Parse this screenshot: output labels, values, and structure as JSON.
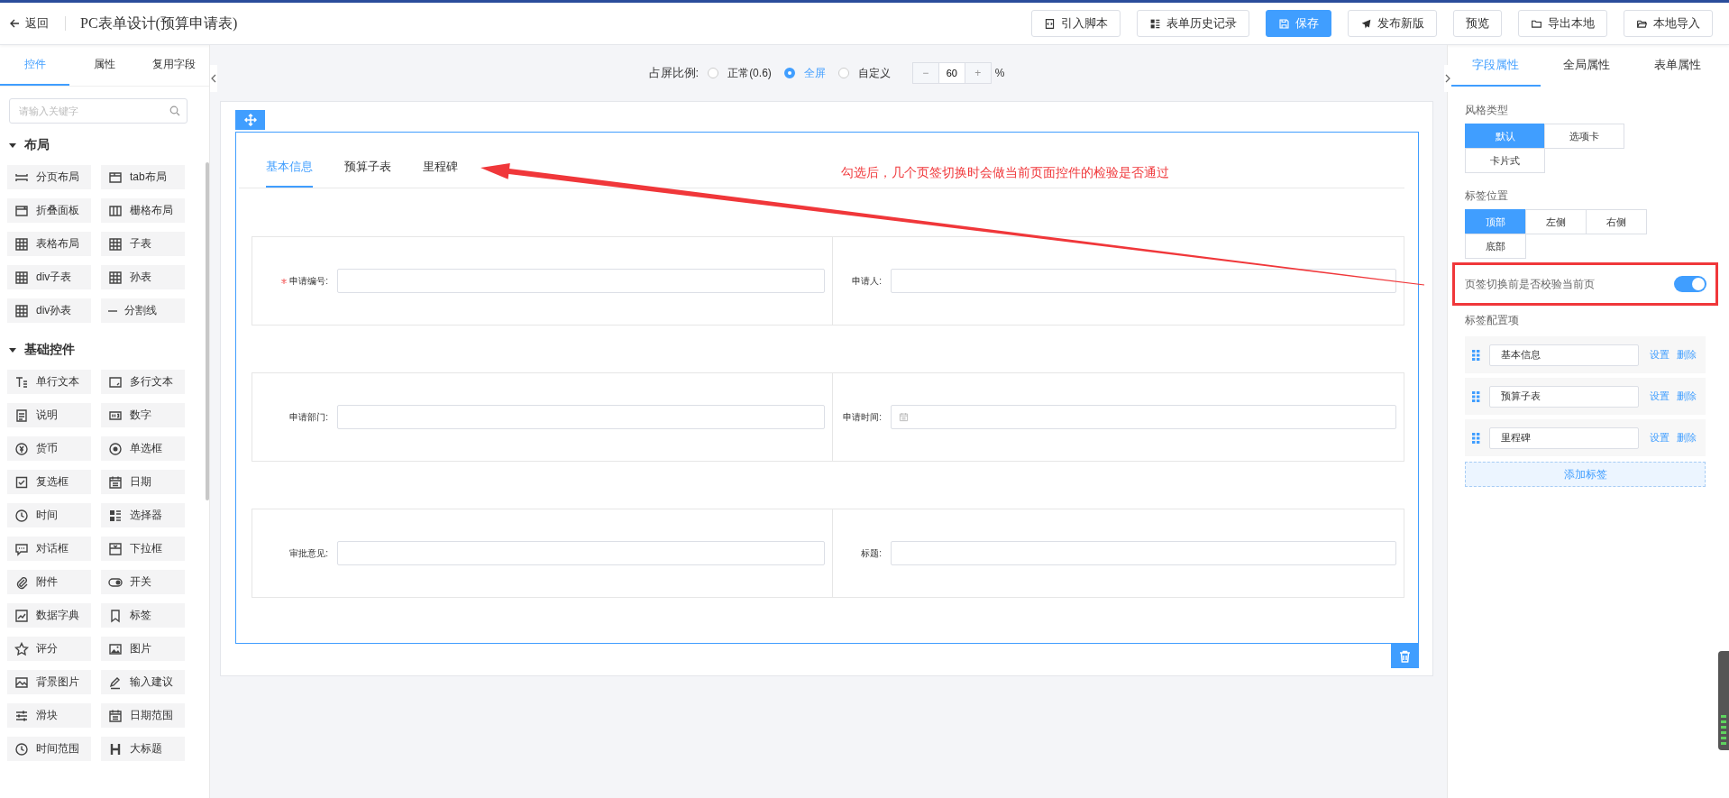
{
  "header": {
    "back_label": "返回",
    "title": "PC表单设计(预算申请表)",
    "buttons": [
      {
        "label": "引入脚本",
        "kind": "script",
        "primary": false
      },
      {
        "label": "表单历史记录",
        "kind": "list",
        "primary": false
      },
      {
        "label": "保存",
        "kind": "save",
        "primary": true
      },
      {
        "label": "发布新版",
        "kind": "send",
        "primary": false
      },
      {
        "label": "预览",
        "kind": "plain",
        "primary": false
      },
      {
        "label": "导出本地",
        "kind": "folder",
        "primary": false
      },
      {
        "label": "本地导入",
        "kind": "folder-open",
        "primary": false
      }
    ]
  },
  "left_panel": {
    "tabs": [
      {
        "label": "控件",
        "selected": true
      },
      {
        "label": "属性",
        "selected": false
      },
      {
        "label": "复用字段",
        "selected": false
      }
    ],
    "search": {
      "placeholder": "请输入关键字"
    },
    "groups": [
      {
        "title": "布局",
        "expanded": true,
        "items": [
          {
            "label": "分页布局",
            "kind": "pages"
          },
          {
            "label": "tab布局",
            "kind": "tab"
          },
          {
            "label": "折叠面板",
            "kind": "panel"
          },
          {
            "label": "栅格布局",
            "kind": "columns"
          },
          {
            "label": "表格布局",
            "kind": "table"
          },
          {
            "label": "子表",
            "kind": "table"
          },
          {
            "label": "div子表",
            "kind": "table"
          },
          {
            "label": "孙表",
            "kind": "table"
          },
          {
            "label": "div孙表",
            "kind": "table"
          },
          {
            "label": "分割线",
            "kind": "divider"
          }
        ]
      },
      {
        "title": "基础控件",
        "expanded": true,
        "items": [
          {
            "label": "单行文本",
            "kind": "text"
          },
          {
            "label": "多行文本",
            "kind": "textarea"
          },
          {
            "label": "说明",
            "kind": "document"
          },
          {
            "label": "数字",
            "kind": "number"
          },
          {
            "label": "货币",
            "kind": "coin"
          },
          {
            "label": "单选框",
            "kind": "radio"
          },
          {
            "label": "复选框",
            "kind": "checkbox"
          },
          {
            "label": "日期",
            "kind": "calendar"
          },
          {
            "label": "时间",
            "kind": "clock"
          },
          {
            "label": "选择器",
            "kind": "list"
          },
          {
            "label": "对话框",
            "kind": "chat"
          },
          {
            "label": "下拉框",
            "kind": "dropdown"
          },
          {
            "label": "附件",
            "kind": "paperclip"
          },
          {
            "label": "开关",
            "kind": "toggle"
          },
          {
            "label": "数据字典",
            "kind": "chart"
          },
          {
            "label": "标签",
            "kind": "bookmark"
          },
          {
            "label": "评分",
            "kind": "star"
          },
          {
            "label": "图片",
            "kind": "image"
          },
          {
            "label": "背景图片",
            "kind": "landscape"
          },
          {
            "label": "输入建议",
            "kind": "pen"
          },
          {
            "label": "滑块",
            "kind": "sliders"
          },
          {
            "label": "日期范围",
            "kind": "calendar"
          },
          {
            "label": "时间范围",
            "kind": "clock"
          },
          {
            "label": "大标题",
            "kind": "heading"
          }
        ]
      }
    ]
  },
  "canvas": {
    "ratio": {
      "label": "占屏比例:",
      "options": [
        {
          "label": "正常(0.6)",
          "selected": false
        },
        {
          "label": "全屏",
          "selected": true
        },
        {
          "label": "自定义",
          "selected": false
        }
      ],
      "minus": "−",
      "value": "60",
      "plus": "+",
      "unit": "%"
    },
    "tabs": [
      {
        "label": "基本信息",
        "selected": true
      },
      {
        "label": "预算子表",
        "selected": false
      },
      {
        "label": "里程碑",
        "selected": false
      }
    ],
    "rows": [
      [
        {
          "label": "申请编号:",
          "required": true,
          "kind": "text"
        },
        {
          "label": "申请人:",
          "required": false,
          "kind": "text"
        }
      ],
      [
        {
          "label": "申请部门:",
          "required": false,
          "kind": "text"
        },
        {
          "label": "申请时间:",
          "required": false,
          "kind": "date"
        }
      ],
      [
        {
          "label": "审批意见:",
          "required": false,
          "kind": "text"
        },
        {
          "label": "标题:",
          "required": false,
          "kind": "text"
        }
      ]
    ],
    "annotation": "勾选后，几个页签切换时会做当前页面控件的检验是否通过"
  },
  "right_panel": {
    "tabs": [
      {
        "label": "字段属性",
        "selected": true
      },
      {
        "label": "全局属性",
        "selected": false
      },
      {
        "label": "表单属性",
        "selected": false
      }
    ],
    "style_type": {
      "label": "风格类型",
      "options": [
        {
          "label": "默认",
          "selected": true
        },
        {
          "label": "选项卡",
          "selected": false
        },
        {
          "label": "卡片式",
          "selected": false
        }
      ]
    },
    "tab_position": {
      "label": "标签位置",
      "options": [
        {
          "label": "顶部",
          "selected": true
        },
        {
          "label": "左侧",
          "selected": false
        },
        {
          "label": "右侧",
          "selected": false
        },
        {
          "label": "底部",
          "selected": false
        }
      ]
    },
    "validate_toggle": {
      "label": "页签切换前是否校验当前页",
      "on": true
    },
    "tag_config": {
      "label": "标签配置项",
      "items": [
        {
          "name": "基本信息",
          "edit": "设置",
          "delete": "删除"
        },
        {
          "name": "预算子表",
          "edit": "设置",
          "delete": "删除"
        },
        {
          "name": "里程碑",
          "edit": "设置",
          "delete": "删除"
        }
      ],
      "add": "添加标签"
    }
  }
}
